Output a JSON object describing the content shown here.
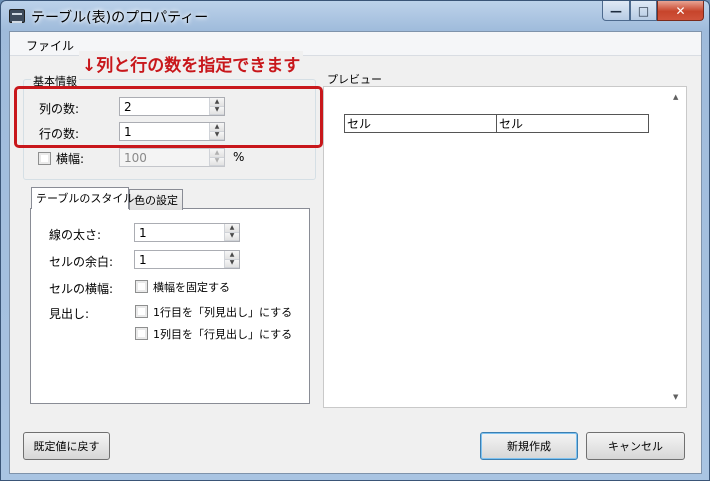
{
  "window": {
    "title": "テーブル(表)のプロパティー"
  },
  "menu": {
    "file": "ファイル"
  },
  "annotation": {
    "text": "↓列と行の数を指定できます"
  },
  "basic": {
    "group_label": "基本情報",
    "columns_label": "列の数:",
    "columns_value": "2",
    "rows_label": "行の数:",
    "rows_value": "1",
    "width_label": "横幅:",
    "width_value": "100",
    "width_unit": "%"
  },
  "tabs": {
    "style": "テーブルのスタイル",
    "color": "色の設定"
  },
  "style": {
    "line_width_label": "線の太さ:",
    "line_width_value": "1",
    "cell_padding_label": "セルの余白:",
    "cell_padding_value": "1",
    "cell_width_label": "セルの横幅:",
    "fix_width_label": "横幅を固定する",
    "headers_label": "見出し:",
    "first_row_header_label": "1行目を「列見出し」にする",
    "first_col_header_label": "1列目を「行見出し」にする"
  },
  "preview": {
    "label": "プレビュー",
    "cells": [
      "セル",
      "セル"
    ]
  },
  "buttons": {
    "reset": "既定値に戻す",
    "create": "新規作成",
    "cancel": "キャンセル"
  },
  "colors": {
    "annotation": "#c8171b",
    "title_bar": "#a9c4e2",
    "close_button": "#c7442b"
  }
}
